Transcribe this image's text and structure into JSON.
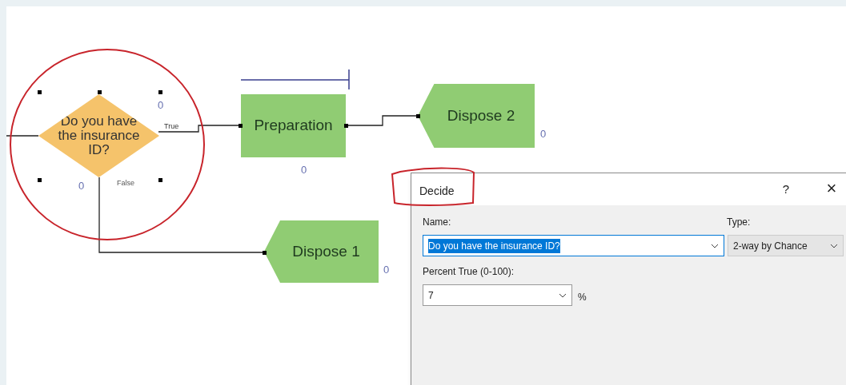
{
  "diagram": {
    "decision": {
      "label": "Do you have the insurance ID?",
      "selected": true,
      "counters": [
        "0",
        "0"
      ],
      "true_label": "True",
      "false_label": "False"
    },
    "modules": [
      {
        "kind": "process",
        "label": "Preparation",
        "counter": "0"
      },
      {
        "kind": "dispose",
        "label": "Dispose 2",
        "counter": "0"
      },
      {
        "kind": "dispose",
        "label": "Dispose 1",
        "counter": "0"
      }
    ]
  },
  "dialog": {
    "title": "Decide",
    "help": "?",
    "close": "×",
    "name_field": {
      "label": "Name:",
      "value": "Do you have the insurance ID?",
      "highlighted": true
    },
    "type_field": {
      "label": "Type:",
      "value": "2-way by Chance"
    },
    "percent_field": {
      "label": "Percent True (0-100):",
      "value": "7",
      "unit": "%"
    }
  }
}
